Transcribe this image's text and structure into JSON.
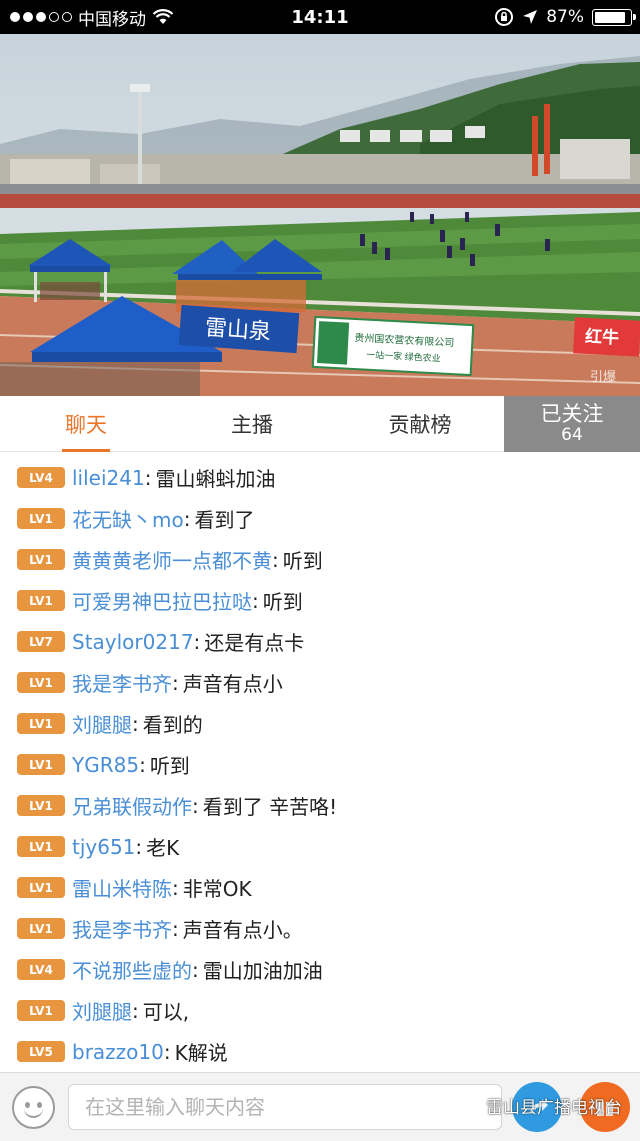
{
  "status_bar": {
    "carrier": "中国移动",
    "time": "14:11",
    "battery": "87%",
    "battery_level": 0.87,
    "signal_dots": 3,
    "signal_dots_total": 5
  },
  "video": {
    "banner_mountain_spring": "雷山泉",
    "banner_company": "贵州国农营农有限公司",
    "banner_company_sub": "一站一家  绿色农业",
    "banner_red": "红牛",
    "corner_mark": "引爆"
  },
  "tabs": {
    "chat": "聊天",
    "host": "主播",
    "ranking": "贡献榜",
    "active": "chat"
  },
  "follow": {
    "label": "已关注",
    "count": "64"
  },
  "messages": [
    {
      "level": "LV4",
      "user": "lilei241",
      "text": "雷山蝌蚪加油"
    },
    {
      "level": "LV1",
      "user": "花无缺丶mo",
      "text": "看到了"
    },
    {
      "level": "LV1",
      "user": "黄黄黄老师一点都不黄",
      "text": "听到"
    },
    {
      "level": "LV1",
      "user": "可爱男神巴拉巴拉哒",
      "text": "听到"
    },
    {
      "level": "LV7",
      "user": "Staylor0217",
      "text": "还是有点卡"
    },
    {
      "level": "LV1",
      "user": "我是李书齐",
      "text": "声音有点小"
    },
    {
      "level": "LV1",
      "user": "刘腿腿",
      "text": "看到的"
    },
    {
      "level": "LV1",
      "user": "YGR85",
      "text": "听到"
    },
    {
      "level": "LV1",
      "user": "兄弟联假动作",
      "text": "看到了  辛苦咯!"
    },
    {
      "level": "LV1",
      "user": "tjy651",
      "text": "老K"
    },
    {
      "level": "LV1",
      "user": "雷山米特陈",
      "text": "非常OK"
    },
    {
      "level": "LV1",
      "user": "我是李书齐",
      "text": "声音有点小。"
    },
    {
      "level": "LV4",
      "user": "不说那些虚的",
      "text": "雷山加油加油"
    },
    {
      "level": "LV1",
      "user": "刘腿腿",
      "text": "可以,"
    },
    {
      "level": "LV5",
      "user": "brazzo10",
      "text": "K解说"
    }
  ],
  "input": {
    "placeholder": "在这里输入聊天内容"
  },
  "watermark": "雷山县广播电视台",
  "icons": {
    "emoji": "smiley-icon",
    "share": "share-icon",
    "gift": "gift-icon",
    "wifi": "wifi-icon",
    "lock": "rotation-lock-icon",
    "location": "location-arrow-icon",
    "battery": "battery-icon",
    "wechat": "wechat-icon"
  },
  "colors": {
    "accent": "#e8772c",
    "level_badge": "#e8953f",
    "username": "#4a8fd6",
    "follow_bg": "#8a8a8a",
    "share_button": "#2f9ae0",
    "gift_button": "#f06a22"
  }
}
